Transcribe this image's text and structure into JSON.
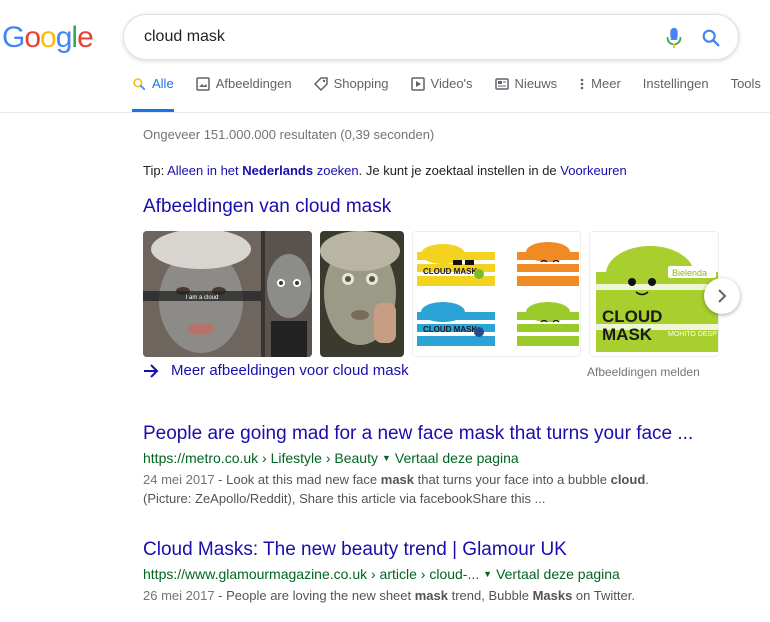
{
  "search": {
    "query": "cloud mask"
  },
  "tabs": [
    {
      "label": "Alle"
    },
    {
      "label": "Afbeeldingen"
    },
    {
      "label": "Shopping"
    },
    {
      "label": "Video's"
    },
    {
      "label": "Nieuws"
    },
    {
      "label": "Meer"
    },
    {
      "label": "Instellingen"
    },
    {
      "label": "Tools"
    }
  ],
  "stats": "Ongeveer 151.000.000 resultaten (0,39 seconden)",
  "tip": {
    "prefix": "Tip: ",
    "link1": "Alleen in het",
    "lang": "Nederlands",
    "link2": "zoeken",
    "middle": ". Je kunt je zoektaal instellen in de ",
    "prefs": "Voorkeuren"
  },
  "images": {
    "heading": "Afbeeldingen van cloud mask",
    "more_label": "Meer afbeeldingen voor cloud mask",
    "report_label": "Afbeeldingen melden",
    "caption": "I am a cloud",
    "product_brand": "CLOUD MASK",
    "product_line1": "CLOUD",
    "product_line2": "MASK",
    "product_brand_tag": "Bielenda",
    "product_flavor": "MOHITO DESP"
  },
  "results": [
    {
      "title": "People are going mad for a new face mask that turns your face ...",
      "url": "https://metro.co.uk › Lifestyle › Beauty",
      "translate": "Vertaal deze pagina",
      "date": "24 mei 2017",
      "snippet_line1_a": " - Look at this mad new face ",
      "snippet_line1_b": "mask",
      "snippet_line1_c": " that turns your face into a bubble ",
      "snippet_line1_d": "cloud",
      "snippet_line1_e": ".",
      "snippet_line2": "(Picture: ZeApollo/Reddit), Share this article via facebookShare this ..."
    },
    {
      "title": "Cloud Masks: The new beauty trend | Glamour UK",
      "url": "https://www.glamourmagazine.co.uk › article › cloud-...",
      "translate": "Vertaal deze pagina",
      "date": "26 mei 2017",
      "snippet_a": " - People are loving the new sheet ",
      "snippet_b": "mask",
      "snippet_c": " trend, Bubble ",
      "snippet_d": "Masks",
      "snippet_e": " on Twitter."
    }
  ],
  "colors": {
    "link": "#1a0dab",
    "url_green": "#006621",
    "accent_blue": "#1a73e8"
  }
}
